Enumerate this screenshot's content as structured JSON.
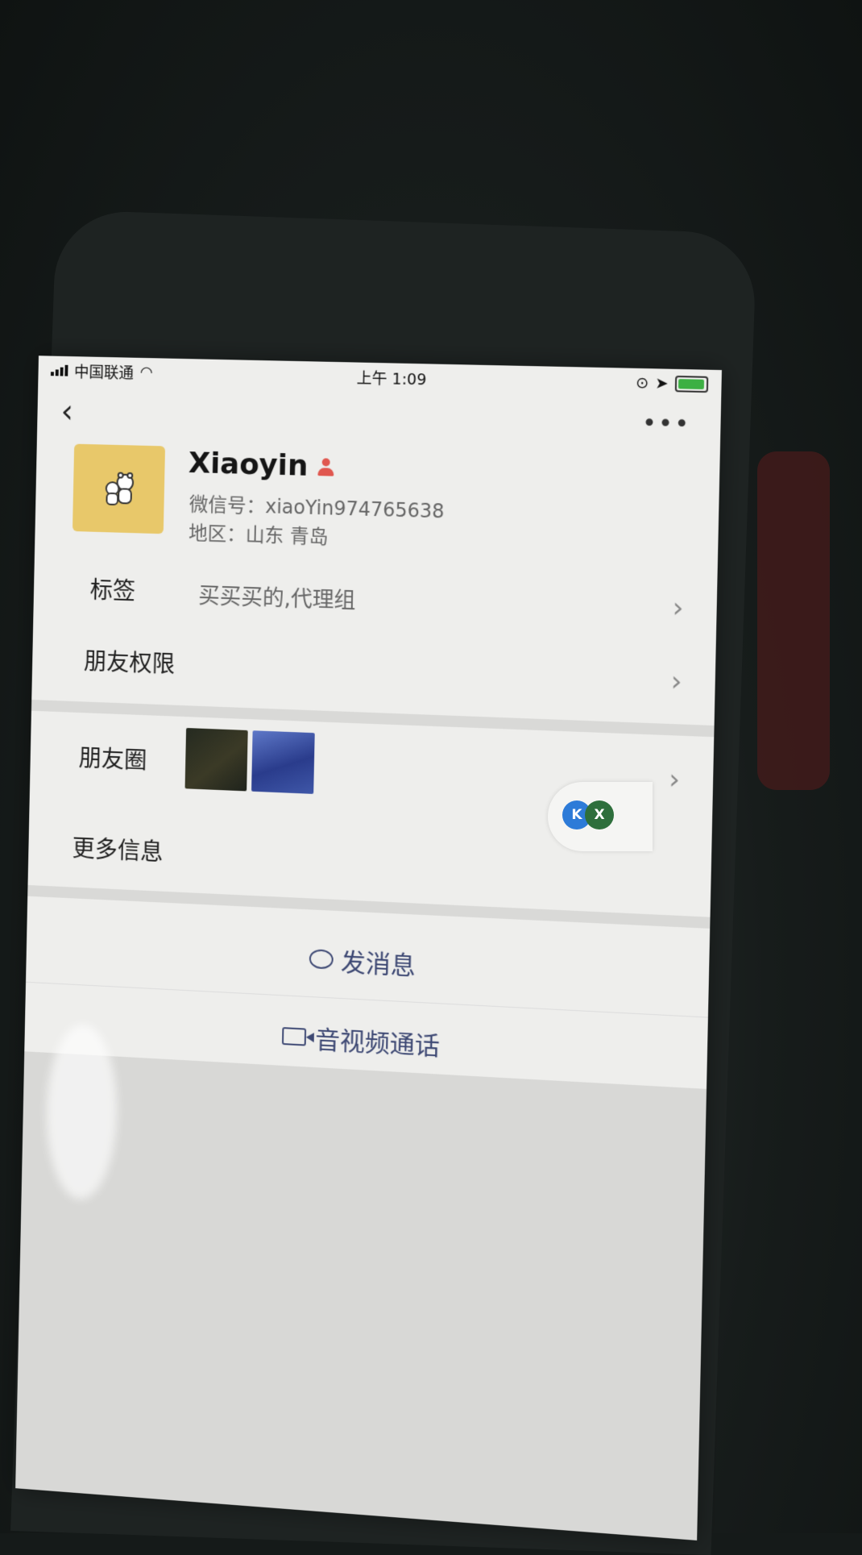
{
  "status_bar": {
    "carrier": "中国联通",
    "time": "上午 1:09",
    "signal_icon": "signal-bars-icon",
    "wifi_icon": "wifi-icon",
    "location_icon": "location-arrow-icon",
    "battery_icon": "battery-charging-icon"
  },
  "nav": {
    "back_icon": "chevron-left-icon",
    "more_icon": "ellipsis-icon"
  },
  "profile": {
    "name": "Xiaoyin",
    "wechat_id": "微信号：xiaoYin974765638",
    "region": "地区：山东 青岛",
    "avatar_color": "#e8c86a"
  },
  "rows": {
    "tags_label": "标签",
    "tags_value": "买买买的,代理组",
    "friend_permissions_label": "朋友权限",
    "moments_label": "朋友圈",
    "more_info_label": "更多信息"
  },
  "floating_badge": {
    "k_letter": "K",
    "x_letter": "X"
  },
  "actions": {
    "send_message": "发消息",
    "video_call": "音视频通话"
  },
  "colors": {
    "screen_bg": "#eeeeec",
    "action_text": "#3d4873",
    "gender_icon": "#e0574f"
  }
}
